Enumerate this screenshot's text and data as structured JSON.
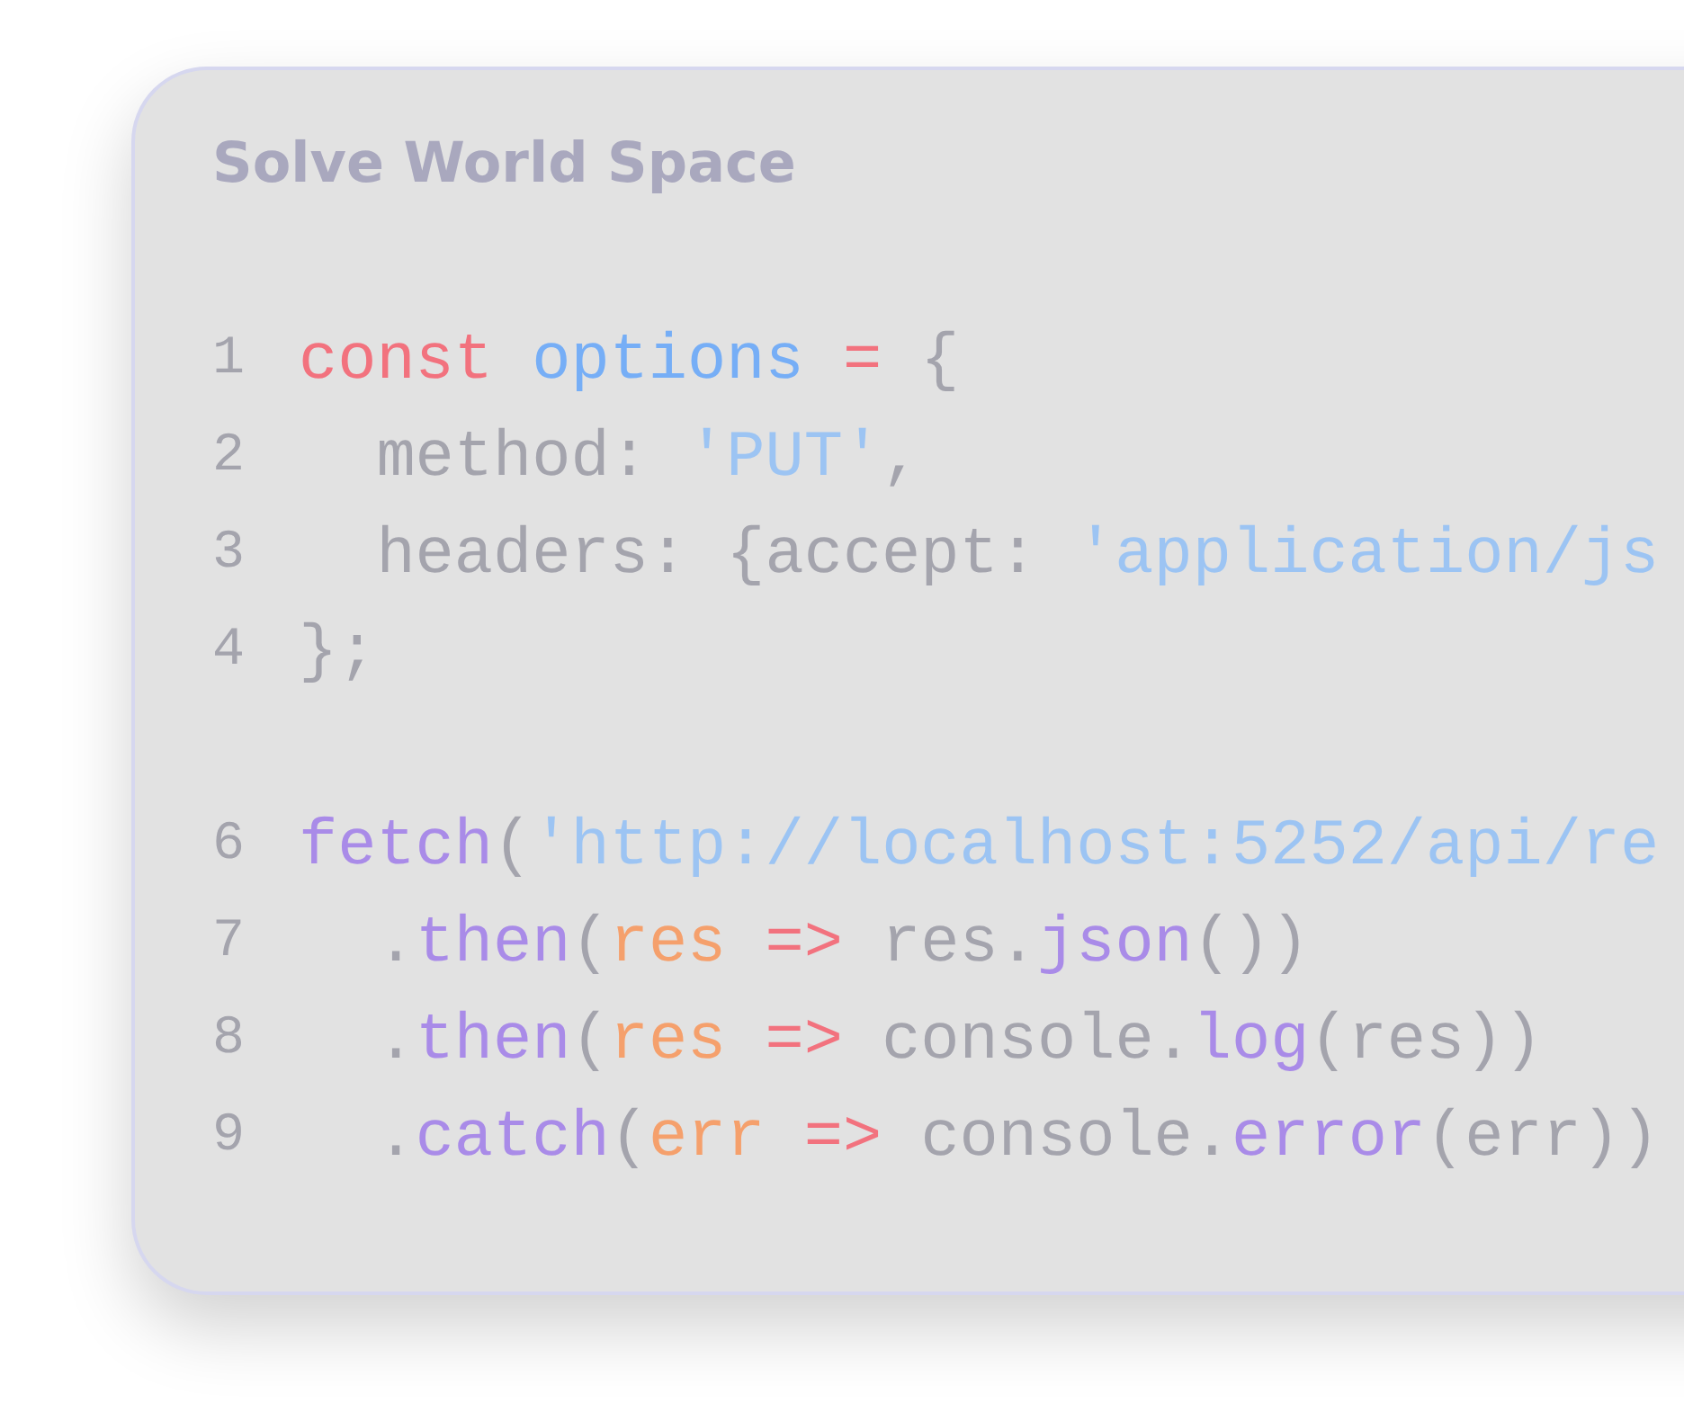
{
  "card": {
    "title": "Solve World Space"
  },
  "code": {
    "lines": [
      {
        "kind": "code",
        "number": "1",
        "tokens": [
          {
            "text": "const ",
            "kind": "keyword"
          },
          {
            "text": "options ",
            "kind": "variable"
          },
          {
            "text": "= ",
            "kind": "operator"
          },
          {
            "text": "{",
            "kind": "plain"
          }
        ]
      },
      {
        "kind": "code",
        "number": "2",
        "tokens": [
          {
            "text": "  method: ",
            "kind": "plain"
          },
          {
            "text": "'PUT'",
            "kind": "string"
          },
          {
            "text": ",",
            "kind": "plain"
          }
        ]
      },
      {
        "kind": "code",
        "number": "3",
        "tokens": [
          {
            "text": "  headers: {accept: ",
            "kind": "plain"
          },
          {
            "text": "'application/js",
            "kind": "string"
          }
        ]
      },
      {
        "kind": "code",
        "number": "4",
        "tokens": [
          {
            "text": "};",
            "kind": "plain"
          }
        ]
      },
      {
        "kind": "blank"
      },
      {
        "kind": "code",
        "number": "6",
        "tokens": [
          {
            "text": "fetch",
            "kind": "function"
          },
          {
            "text": "(",
            "kind": "plain"
          },
          {
            "text": "'http://localhost:5252/api/re",
            "kind": "string"
          }
        ]
      },
      {
        "kind": "code",
        "number": "7",
        "tokens": [
          {
            "text": "  .",
            "kind": "plain"
          },
          {
            "text": "then",
            "kind": "function"
          },
          {
            "text": "(",
            "kind": "plain"
          },
          {
            "text": "res ",
            "kind": "param"
          },
          {
            "text": "=> ",
            "kind": "operator"
          },
          {
            "text": "res.",
            "kind": "plain"
          },
          {
            "text": "json",
            "kind": "function"
          },
          {
            "text": "())",
            "kind": "plain"
          }
        ]
      },
      {
        "kind": "code",
        "number": "8",
        "tokens": [
          {
            "text": "  .",
            "kind": "plain"
          },
          {
            "text": "then",
            "kind": "function"
          },
          {
            "text": "(",
            "kind": "plain"
          },
          {
            "text": "res ",
            "kind": "param"
          },
          {
            "text": "=> ",
            "kind": "operator"
          },
          {
            "text": "console.",
            "kind": "plain"
          },
          {
            "text": "log",
            "kind": "function"
          },
          {
            "text": "(res))",
            "kind": "plain"
          }
        ]
      },
      {
        "kind": "code",
        "number": "9",
        "tokens": [
          {
            "text": "  .",
            "kind": "plain"
          },
          {
            "text": "catch",
            "kind": "function"
          },
          {
            "text": "(",
            "kind": "plain"
          },
          {
            "text": "err ",
            "kind": "param"
          },
          {
            "text": "=> ",
            "kind": "operator"
          },
          {
            "text": "console.",
            "kind": "plain"
          },
          {
            "text": "error",
            "kind": "function"
          },
          {
            "text": "(err))",
            "kind": "plain"
          }
        ]
      }
    ]
  }
}
